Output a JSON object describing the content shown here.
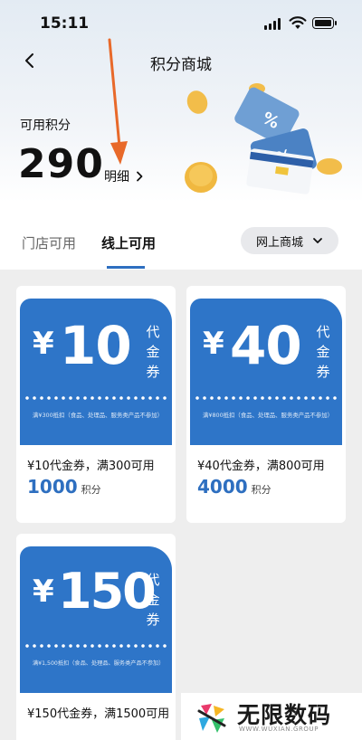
{
  "status": {
    "time": "15:11"
  },
  "header": {
    "title": "积分商城"
  },
  "points": {
    "label": "可用积分",
    "value": "290",
    "detail_label": "明细"
  },
  "tabs": [
    {
      "label": "门店可用",
      "active": false
    },
    {
      "label": "线上可用",
      "active": true
    }
  ],
  "mall_dropdown": {
    "label": "网上商城"
  },
  "coupons": [
    {
      "amount": "10",
      "yen": "¥",
      "word": "代金券",
      "note": "满¥300抵扣（食品、处理品、服务类产品不参加）",
      "name": "¥10代金券，满300可用",
      "points": "1000",
      "unit": "积分"
    },
    {
      "amount": "40",
      "yen": "¥",
      "word": "代金券",
      "note": "满¥800抵扣（食品、处理品、服务类产品不参加）",
      "name": "¥40代金券，满800可用",
      "points": "4000",
      "unit": "积分"
    },
    {
      "amount": "150",
      "yen": "¥",
      "word": "代金券",
      "note": "满¥1,500抵扣（食品、处理品、服务类产品不参加）",
      "name": "¥150代金券，满1500可用",
      "points": "",
      "unit": ""
    }
  ],
  "watermark": {
    "text": "无限数码",
    "sub": "WWW.WUXIAN.GROUP"
  },
  "colors": {
    "accent": "#2e75c8",
    "annotation_arrow": "#e8692a",
    "coin": "#f0b840"
  }
}
